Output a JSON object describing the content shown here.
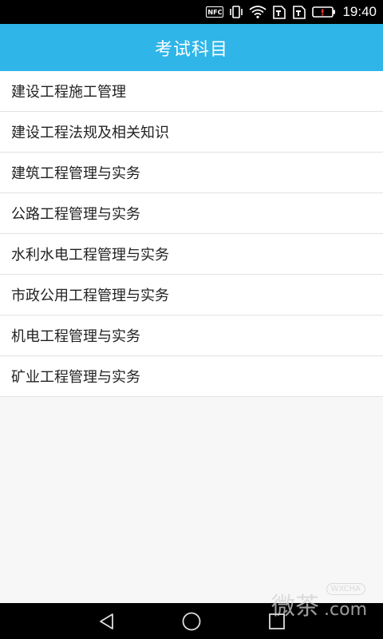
{
  "status_bar": {
    "nfc_label": "NFC",
    "time": "19:40"
  },
  "header": {
    "title": "考试科目"
  },
  "subjects": [
    "建设工程施工管理",
    "建设工程法规及相关知识",
    "建筑工程管理与实务",
    "公路工程管理与实务",
    "水利水电工程管理与实务",
    "市政公用工程管理与实务",
    "机电工程管理与实务",
    "矿业工程管理与实务"
  ],
  "watermark": {
    "main": "微茶",
    "badge": "WXCHA",
    "suffix": ".com"
  },
  "colors": {
    "accent": "#2fb5e8",
    "status_bar": "#000000",
    "battery_alert": "#e53935"
  }
}
